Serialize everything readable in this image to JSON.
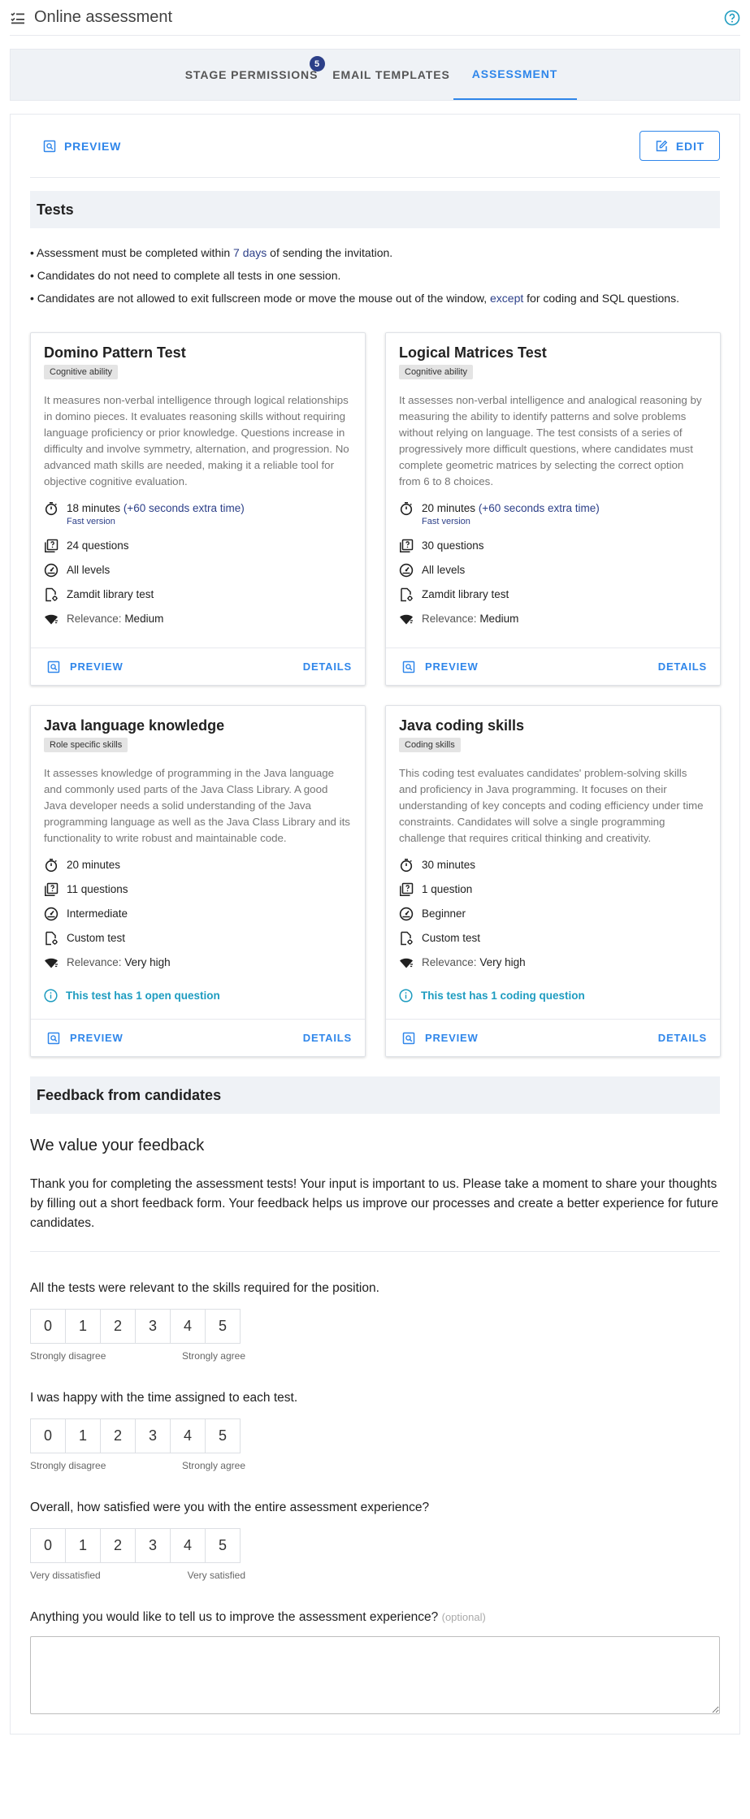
{
  "header": {
    "title": "Online assessment"
  },
  "tabs": [
    {
      "label": "STAGE PERMISSIONS",
      "badge": "5"
    },
    {
      "label": "EMAIL TEMPLATES"
    },
    {
      "label": "ASSESSMENT"
    }
  ],
  "toolbar": {
    "preview_label": "PREVIEW",
    "edit_label": "EDIT"
  },
  "tests_section": {
    "heading": "Tests",
    "rules": [
      {
        "pre": "Assessment must be completed within ",
        "highlight": "7 days",
        "post": " of sending the invitation."
      },
      {
        "pre": "Candidates do not need to complete all tests in one session.",
        "highlight": "",
        "post": ""
      },
      {
        "pre": "Candidates are not allowed to exit fullscreen mode or move the mouse out of the window, ",
        "highlight": "except",
        "post": " for coding and SQL questions."
      }
    ]
  },
  "tests": [
    {
      "title": "Domino Pattern Test",
      "category": "Cognitive ability",
      "description": "It measures non-verbal intelligence through logical relationships in domino pieces. It evaluates reasoning skills without requiring language proficiency or prior knowledge. Questions increase in difficulty and involve symmetry, alternation, and progression. No advanced math skills are needed, making it a reliable tool for objective cognitive evaluation.",
      "duration": "18 minutes",
      "extra_time": "(+60 seconds extra time)",
      "version": "Fast version",
      "questions": "24 questions",
      "level": "All levels",
      "source": "Zamdit library test",
      "relevance_label": "Relevance:",
      "relevance": "Medium",
      "note": "",
      "preview_label": "PREVIEW",
      "details_label": "DETAILS"
    },
    {
      "title": "Logical Matrices Test",
      "category": "Cognitive ability",
      "description": "It assesses non-verbal intelligence and analogical reasoning by measuring the ability to identify patterns and solve problems without relying on language. The test consists of a series of progressively more difficult questions, where candidates must complete geometric matrices by selecting the correct option from 6 to 8 choices.",
      "duration": "20 minutes",
      "extra_time": "(+60 seconds extra time)",
      "version": "Fast version",
      "questions": "30 questions",
      "level": "All levels",
      "source": "Zamdit library test",
      "relevance_label": "Relevance:",
      "relevance": "Medium",
      "note": "",
      "preview_label": "PREVIEW",
      "details_label": "DETAILS"
    },
    {
      "title": "Java language knowledge",
      "category": "Role specific skills",
      "description": "It assesses knowledge of programming in the Java language and commonly used parts of the Java Class Library. A good Java developer needs a solid understanding of the Java programming language as well as the Java Class Library and its functionality to write robust and maintainable code.",
      "duration": "20 minutes",
      "extra_time": "",
      "version": "",
      "questions": "11 questions",
      "level": "Intermediate",
      "source": "Custom test",
      "relevance_label": "Relevance:",
      "relevance": "Very high",
      "note": "This test has 1 open question",
      "preview_label": "PREVIEW",
      "details_label": "DETAILS"
    },
    {
      "title": "Java coding skills",
      "category": "Coding skills",
      "description": "This coding test evaluates candidates' problem-solving skills and proficiency in Java programming. It focuses on their understanding of key concepts and coding efficiency under time constraints. Candidates will solve a single programming challenge that requires critical thinking and creativity.",
      "duration": "30 minutes",
      "extra_time": "",
      "version": "",
      "questions": "1 question",
      "level": "Beginner",
      "source": "Custom test",
      "relevance_label": "Relevance:",
      "relevance": "Very high",
      "note": "This test has 1 coding question",
      "preview_label": "PREVIEW",
      "details_label": "DETAILS"
    }
  ],
  "feedback": {
    "heading": "Feedback from candidates",
    "title": "We value your feedback",
    "intro": "Thank you for completing the assessment tests! Your input is important to us. Please take a moment to share your thoughts by filling out a short feedback form. Your feedback helps us improve our processes and create a better experience for future candidates.",
    "scale": [
      "0",
      "1",
      "2",
      "3",
      "4",
      "5"
    ],
    "questions": [
      {
        "text": "All the tests were relevant to the skills required for the position.",
        "min_label": "Strongly disagree",
        "max_label": "Strongly agree"
      },
      {
        "text": "I was happy with the time assigned to each test.",
        "min_label": "Strongly disagree",
        "max_label": "Strongly agree"
      },
      {
        "text": "Overall, how satisfied were you with the entire assessment experience?",
        "min_label": "Very dissatisfied",
        "max_label": "Very satisfied"
      }
    ],
    "open_question": "Anything you would like to tell us to improve the assessment experience?",
    "open_question_optional": "(optional)",
    "open_answer": ""
  },
  "colors": {
    "accent": "#2f86ea",
    "navy": "#2c3f88",
    "info": "#1e9cc0",
    "section_bg": "#eff2f6"
  }
}
